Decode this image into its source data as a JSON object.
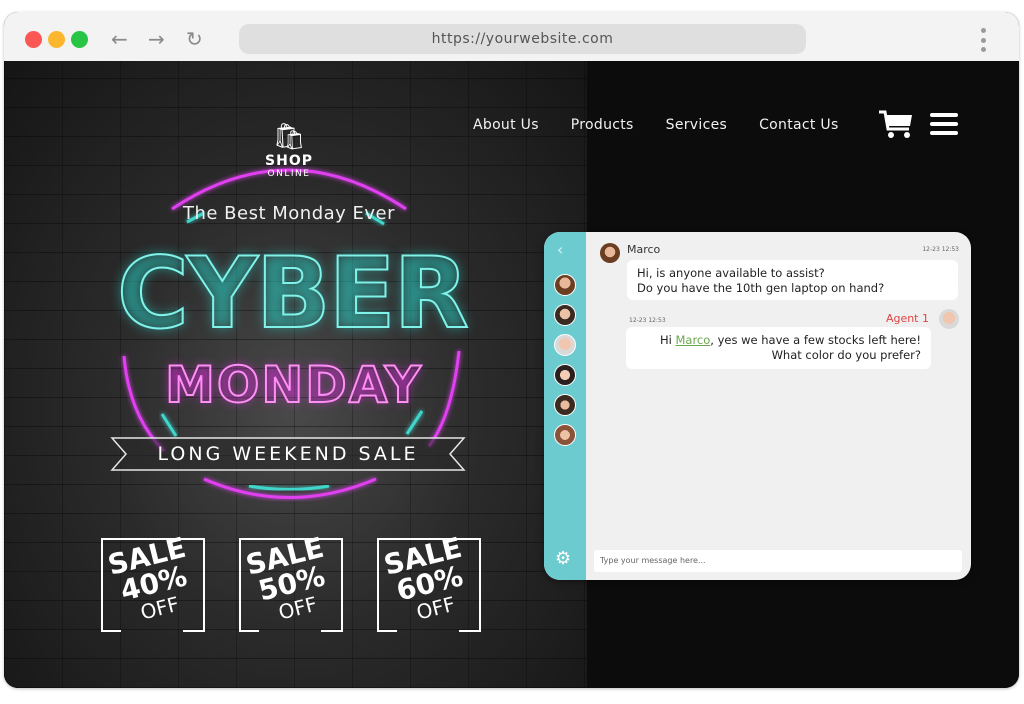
{
  "browser": {
    "url": "https://yourwebsite.com",
    "icons": {
      "back": "arrow-left-icon",
      "forward": "arrow-right-icon",
      "reload": "reload-icon",
      "menu": "kebab-menu-icon"
    }
  },
  "nav": {
    "items": [
      "About Us",
      "Products",
      "Services",
      "Contact Us"
    ],
    "icons": {
      "cart": "shopping-cart-icon",
      "menu": "hamburger-menu-icon"
    }
  },
  "hero": {
    "shop_title": "SHOP",
    "shop_subtitle": "ONLINE",
    "tagline": "The Best Monday Ever",
    "headline": "CYBER",
    "subheadline": "MONDAY",
    "ribbon": "LONG WEEKEND SALE",
    "colors": {
      "cyan": "#7ff3ea",
      "magenta": "#e040f0"
    },
    "sales": [
      {
        "label": "SALE",
        "percent": "40%",
        "suffix": "OFF"
      },
      {
        "label": "SALE",
        "percent": "50%",
        "suffix": "OFF"
      },
      {
        "label": "SALE",
        "percent": "60%",
        "suffix": "OFF"
      }
    ]
  },
  "chat": {
    "accent": "#6ccbcf",
    "messages": [
      {
        "sender": "Marco",
        "time": "12-23 12:53",
        "line1": "Hi, is anyone available to assist?",
        "line2": "Do you have the 10th gen laptop on hand?"
      },
      {
        "sender": "Agent 1",
        "time": "12-23 12:53",
        "prefix": "Hi ",
        "mention": "Marco",
        "line1_rest": ", yes we have a few stocks left here!",
        "line2": "What color do you prefer?"
      }
    ],
    "input_placeholder": "Type your message here..."
  }
}
